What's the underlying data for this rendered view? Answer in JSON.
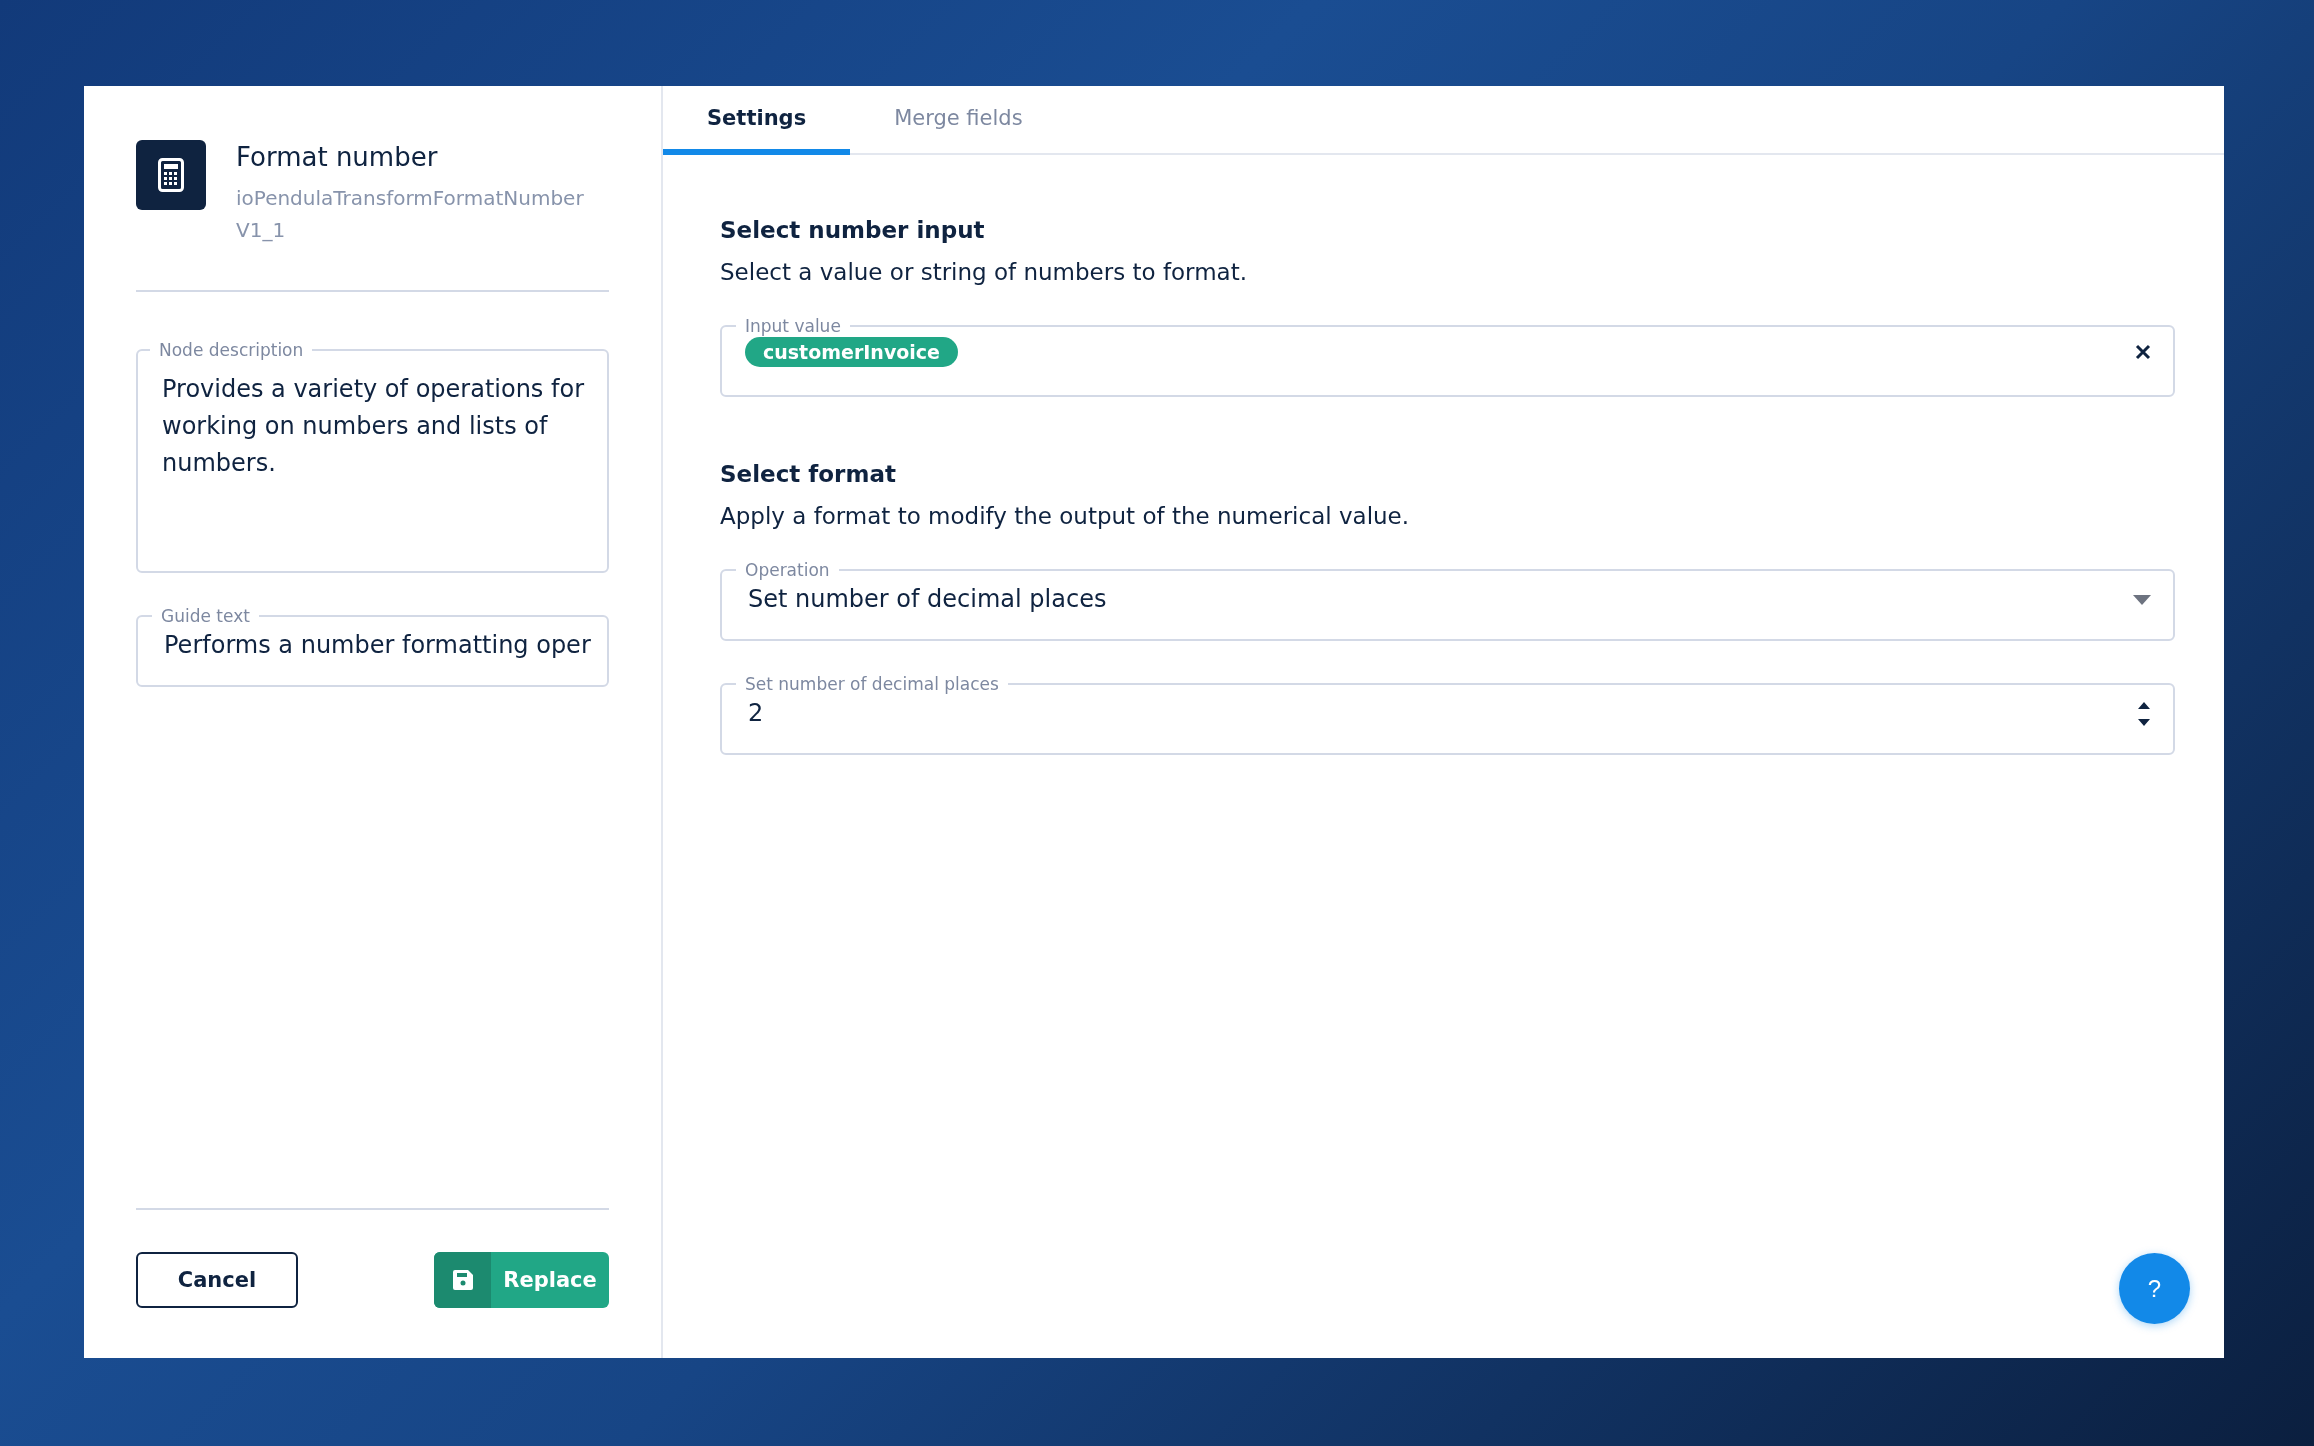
{
  "node": {
    "title": "Format number",
    "subtitle": "ioPendulaTransformFormatNumberV1_1"
  },
  "left_fields": [
    {
      "kind": "textarea",
      "label": "Node description",
      "value": "Provides a variety of operations for working on numbers and lists of numbers."
    },
    {
      "kind": "text",
      "label": "Guide text",
      "value": "Performs a number formatting oper"
    }
  ],
  "actions": {
    "cancel": "Cancel",
    "replace": "Replace"
  },
  "tabs": [
    {
      "label": "Settings",
      "selected": true
    },
    {
      "label": "Merge fields",
      "selected": false
    }
  ],
  "sections": [
    {
      "heading": "Select number input",
      "description": "Select a value or string of numbers to format.",
      "fields": [
        {
          "kind": "chips",
          "label": "Input value",
          "chips": [
            {
              "text": "customerInvoice",
              "color": "#21a786"
            }
          ]
        }
      ]
    },
    {
      "heading": "Select format",
      "description": "Apply a format to modify the output of the numerical value.",
      "fields": [
        {
          "kind": "select",
          "label": "Operation",
          "value": "Set number of decimal places"
        },
        {
          "kind": "number",
          "label": "Set number of decimal places",
          "value": "2"
        }
      ]
    }
  ],
  "help": "?"
}
